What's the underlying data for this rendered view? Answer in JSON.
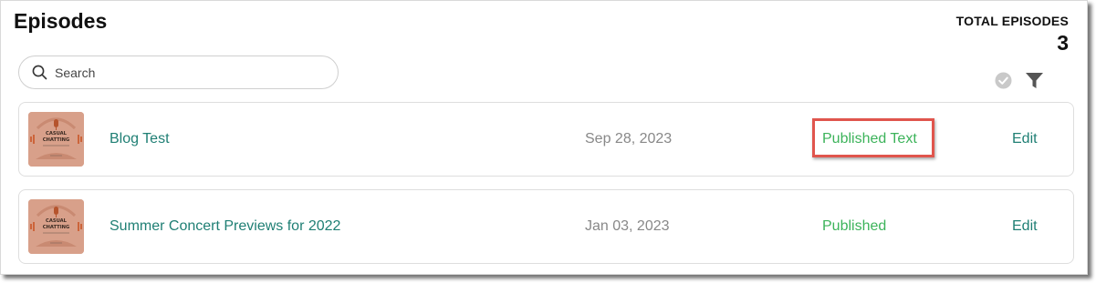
{
  "header": {
    "title": "Episodes",
    "total_label": "TOTAL EPISODES",
    "total_count": "3"
  },
  "search": {
    "placeholder": "Search",
    "value": "",
    "icon": "search-icon"
  },
  "toolbar": {
    "icons": [
      "check-circle-icon",
      "filter-icon"
    ]
  },
  "thumbnail": {
    "line1": "CASUAL",
    "line2": "CHATTING"
  },
  "episodes": [
    {
      "title": "Blog Test",
      "date": "Sep 28, 2023",
      "status": "Published Text",
      "action": "Edit"
    },
    {
      "title": "Summer Concert Previews for 2022",
      "date": "Jan 03, 2023",
      "status": "Published",
      "action": "Edit"
    }
  ],
  "colors": {
    "link": "#1f7f74",
    "published": "#3cb35a",
    "highlight": "#e0554d",
    "date": "#888888"
  }
}
